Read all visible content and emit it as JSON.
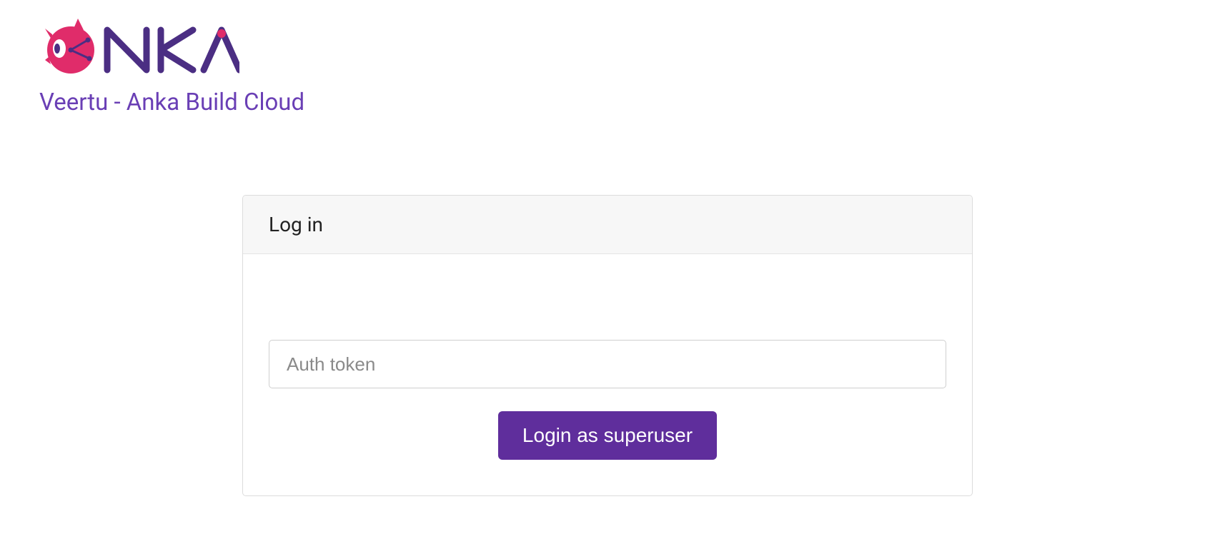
{
  "header": {
    "brand_title": "Veertu - Anka Build Cloud"
  },
  "login": {
    "card_title": "Log in",
    "auth_placeholder": "Auth token",
    "button_label": "Login as superuser"
  },
  "colors": {
    "brand_purple": "#6a3fb5",
    "button_purple": "#5f2e9c",
    "logo_pink": "#e02c6a"
  }
}
